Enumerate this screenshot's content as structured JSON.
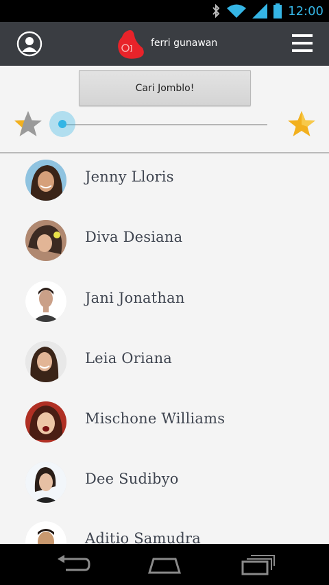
{
  "status_bar": {
    "time": "12:00",
    "icons": [
      "bluetooth-icon",
      "wifi-icon",
      "signal-icon",
      "battery-icon"
    ]
  },
  "header": {
    "username": "ferri gunawan",
    "profile_icon": "user-icon",
    "menu_icon": "hamburger-menu-icon"
  },
  "search": {
    "button_label": "Cari Jomblo!"
  },
  "rating_filter": {
    "min_icon": "star-gray-icon",
    "max_icon": "star-gold-icon",
    "slider_value": 0.0
  },
  "contacts": [
    {
      "name": "Jenny Lloris"
    },
    {
      "name": "Diva Desiana"
    },
    {
      "name": "Jani Jonathan"
    },
    {
      "name": "Leia Oriana"
    },
    {
      "name": "Mischone Williams"
    },
    {
      "name": "Dee Sudibyo"
    },
    {
      "name": "Aditio Samudra"
    }
  ],
  "nav_bar": {
    "buttons": [
      "back-icon",
      "home-icon",
      "recent-apps-icon"
    ]
  },
  "colors": {
    "appbar": "#3a3d42",
    "accent": "#33b5e5",
    "star_gold": "#f2b01e",
    "star_gray": "#9a9a9a",
    "list_bg": "#f4f4f4"
  }
}
